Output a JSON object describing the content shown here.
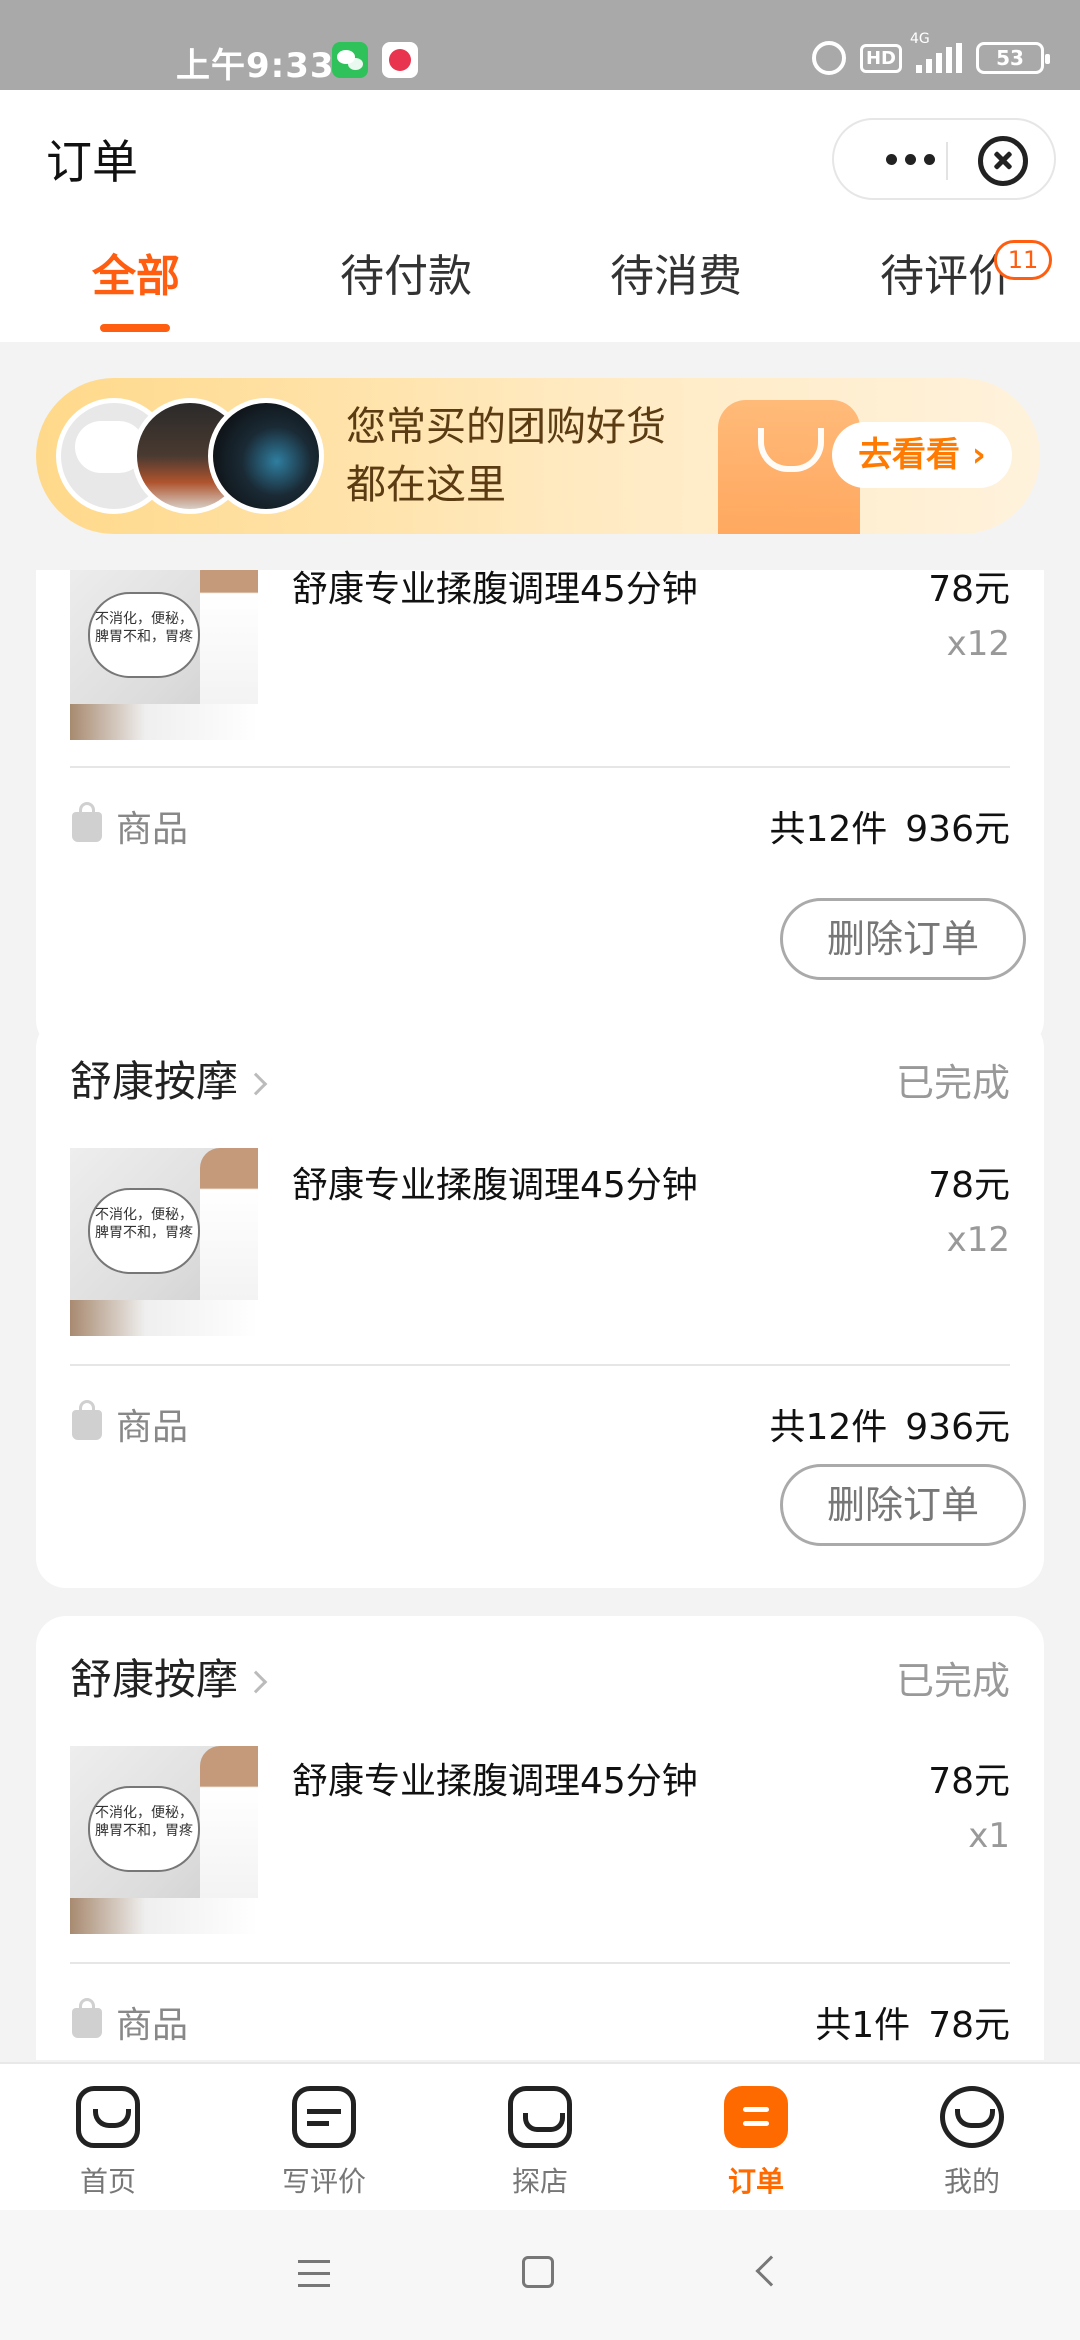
{
  "status_bar": {
    "time": "上午9:33",
    "hd": "HD",
    "network": "4G",
    "battery": "53"
  },
  "header": {
    "title": "订单"
  },
  "tabs": [
    {
      "label": "全部",
      "active": true
    },
    {
      "label": "待付款",
      "active": false
    },
    {
      "label": "待消费",
      "active": false
    },
    {
      "label": "待评价",
      "active": false,
      "badge": "11"
    }
  ],
  "banner": {
    "line1": "您常买的团购好货",
    "line2": "都在这里",
    "button": "去看看 ›"
  },
  "thumbnail_text": "不消化，便秘，脾胃不和，胃疼",
  "orders": [
    {
      "shop": "",
      "status": "",
      "item_name": "舒康专业揉腹调理45分钟",
      "price": "78元",
      "qty": "x12",
      "goods_label": "商品",
      "count": "共12件",
      "total": "936元",
      "action": "删除订单"
    },
    {
      "shop": "舒康按摩",
      "status": "已完成",
      "item_name": "舒康专业揉腹调理45分钟",
      "price": "78元",
      "qty": "x12",
      "goods_label": "商品",
      "count": "共12件",
      "total": "936元",
      "action": "删除订单"
    },
    {
      "shop": "舒康按摩",
      "status": "已完成",
      "item_name": "舒康专业揉腹调理45分钟",
      "price": "78元",
      "qty": "x1",
      "goods_label": "商品",
      "count": "共1件",
      "total": "78元",
      "action": ""
    }
  ],
  "bottom_tabs": [
    {
      "label": "首页",
      "icon": "home-icon"
    },
    {
      "label": "写评价",
      "icon": "write-review-icon"
    },
    {
      "label": "探店",
      "icon": "explore-shop-icon"
    },
    {
      "label": "订单",
      "icon": "orders-icon",
      "active": true
    },
    {
      "label": "我的",
      "icon": "profile-icon"
    }
  ],
  "colors": {
    "accent": "#ff5e10",
    "tab_active": "#ff6a00"
  }
}
